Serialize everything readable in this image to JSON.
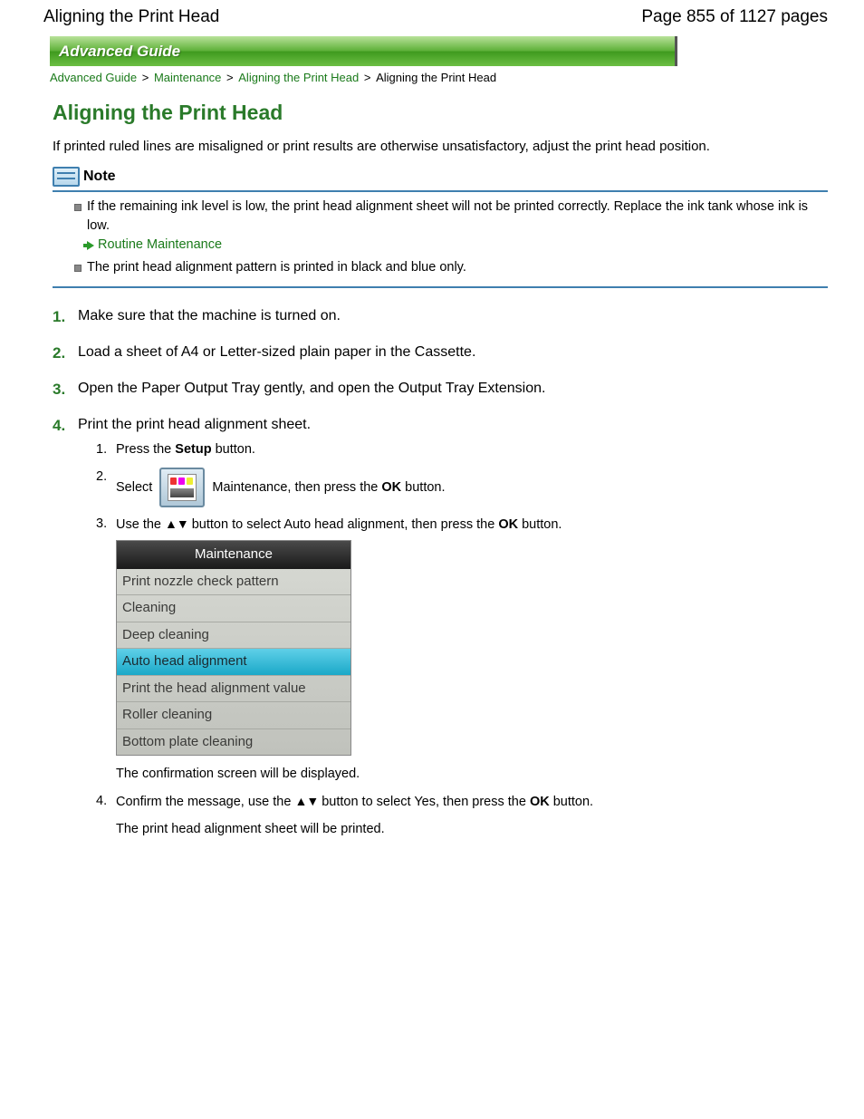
{
  "header": {
    "title": "Aligning the Print Head",
    "page_indicator": "Page 855 of 1127 pages"
  },
  "banner": "Advanced Guide",
  "breadcrumb": {
    "l1": "Advanced Guide",
    "l2": "Maintenance",
    "l3": "Aligning the Print Head",
    "current": "Aligning the Print Head"
  },
  "title": "Aligning the Print Head",
  "intro": "If printed ruled lines are misaligned or print results are otherwise unsatisfactory, adjust the print head position.",
  "note": {
    "label": "Note",
    "items": [
      "If the remaining ink level is low, the print head alignment sheet will not be printed correctly. Replace the ink tank whose ink is low.",
      "The print head alignment pattern is printed in black and blue only."
    ],
    "link": "Routine Maintenance"
  },
  "steps": [
    "Make sure that the machine is turned on.",
    "Load a sheet of A4 or Letter-sized plain paper in the Cassette.",
    "Open the Paper Output Tray gently, and open the Output Tray Extension.",
    "Print the print head alignment sheet."
  ],
  "sub4": {
    "s1_a": "Press the ",
    "s1_b": "Setup",
    "s1_c": " button.",
    "s2_a": "Select ",
    "s2_b": " Maintenance, then press the ",
    "s2_c": "OK",
    "s2_d": " button.",
    "s3_a": "Use the ",
    "s3_b": " button to select Auto head alignment, then press the ",
    "s3_c": "OK",
    "s3_d": " button.",
    "s3_after": "The confirmation screen will be displayed.",
    "s4_a": "Confirm the message, use the ",
    "s4_b": " button to select Yes, then press the ",
    "s4_c": "OK",
    "s4_d": " button.",
    "s4_after": "The print head alignment sheet will be printed."
  },
  "lcd": {
    "title": "Maintenance",
    "items": [
      "Print nozzle check pattern",
      "Cleaning",
      "Deep cleaning",
      "Auto head alignment",
      "Print the head alignment value",
      "Roller cleaning",
      "Bottom plate cleaning"
    ],
    "selected_index": 3
  }
}
